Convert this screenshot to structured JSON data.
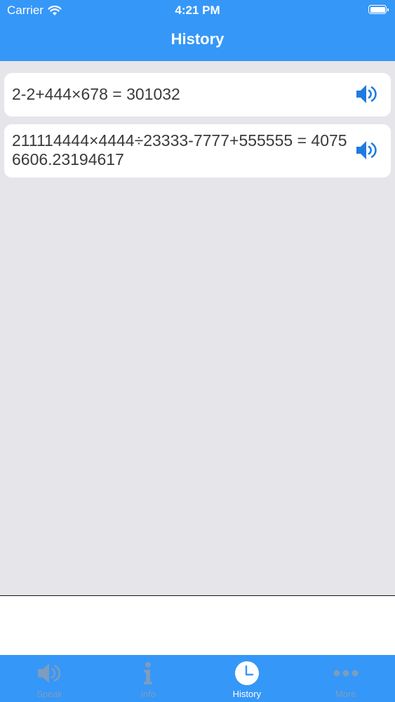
{
  "status_bar": {
    "carrier": "Carrier",
    "time": "4:21 PM"
  },
  "nav": {
    "title": "History"
  },
  "history": [
    {
      "text": "2-2+444×678 = 301032"
    },
    {
      "text": "211114444×4444÷23333-7777+555555 = 40756606.23194617"
    }
  ],
  "tabs": [
    {
      "label": "Speak",
      "icon": "speaker-icon",
      "active": false
    },
    {
      "label": "Info",
      "icon": "info-icon",
      "active": false
    },
    {
      "label": "History",
      "icon": "clock-icon",
      "active": true
    },
    {
      "label": "More",
      "icon": "more-dots-icon",
      "active": false
    }
  ],
  "colors": {
    "accent": "#3597f8",
    "speaker": "#1e7be0",
    "background": "#e6e6ea"
  }
}
